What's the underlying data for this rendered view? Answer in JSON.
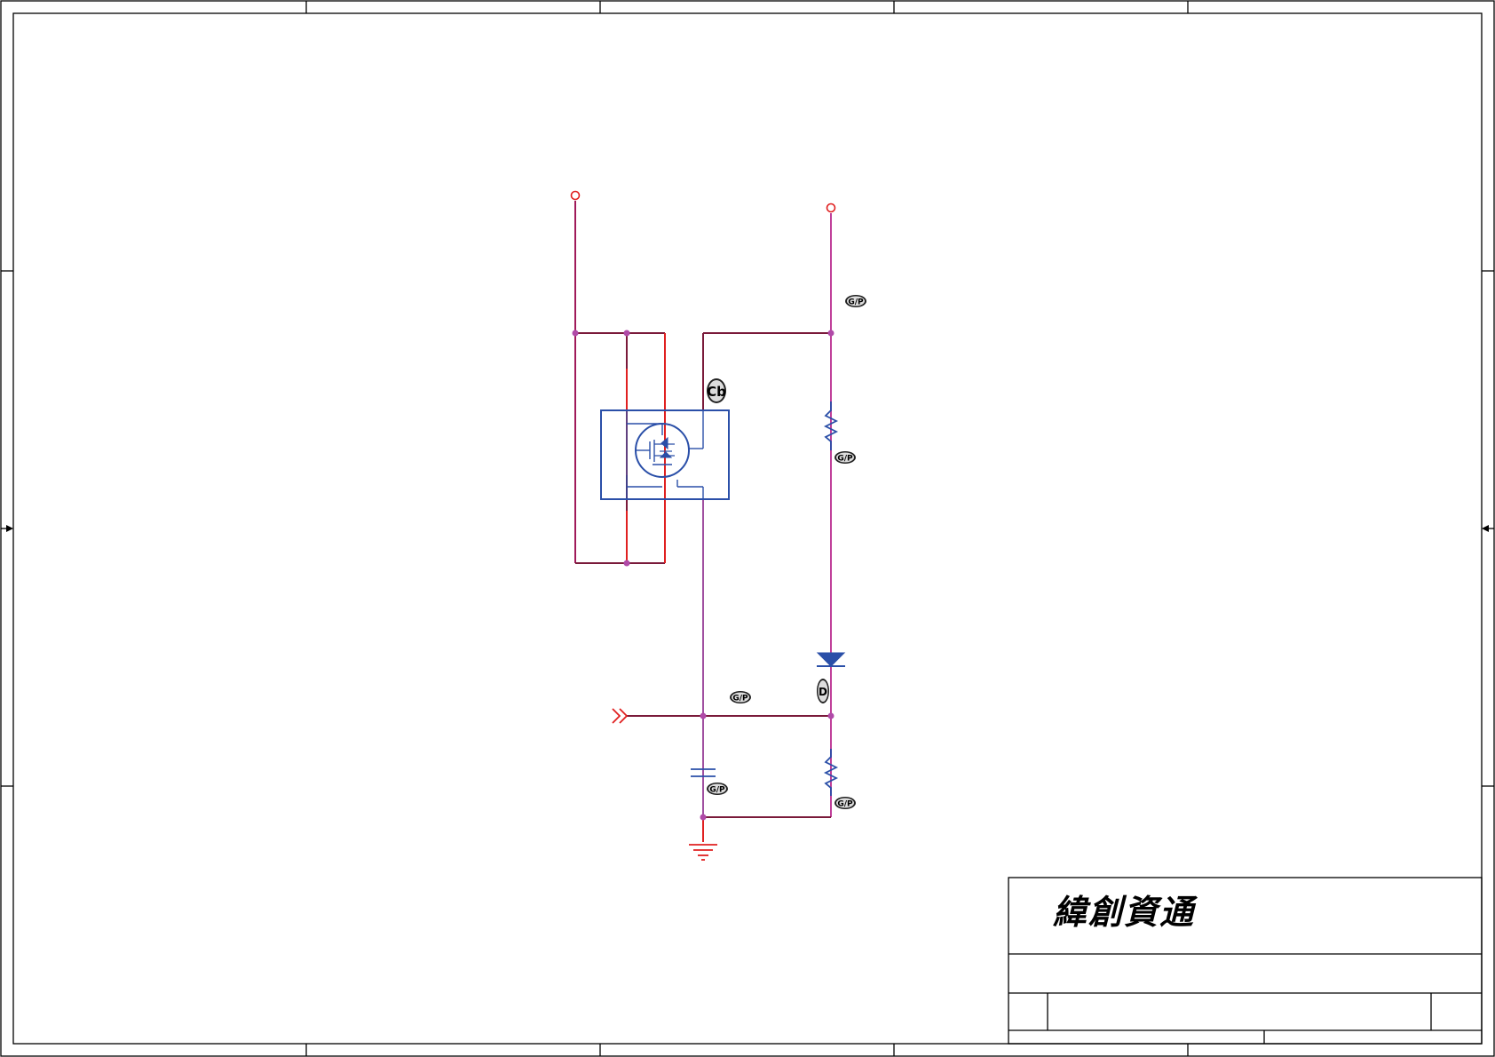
{
  "title_block": {
    "company_logo": "緯創資通"
  },
  "labels": {
    "gp_tag": "G/P",
    "cb_tag": "Cb",
    "d_tag": "D"
  },
  "colors": {
    "wire": "#7a1a3a",
    "wire_red": "#e02020",
    "wire_pink": "#c0409a",
    "component": "#2a4fa8",
    "junction": "#b04aa8",
    "frame": "#000000"
  }
}
